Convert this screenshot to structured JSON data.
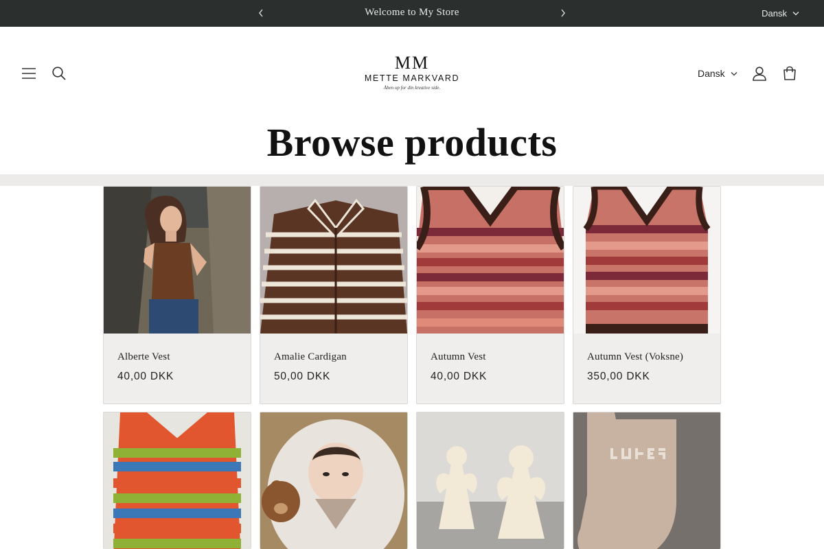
{
  "announcement": {
    "message": "Welcome to My Store",
    "language": "Dansk"
  },
  "header": {
    "logo": {
      "monogram": "MM",
      "brand": "METTE MARKVARD",
      "tagline": "Åben op for din kreative side."
    },
    "language": "Dansk"
  },
  "page": {
    "title": "Browse products"
  },
  "products": [
    {
      "name": "Alberte Vest",
      "price": "40,00 DKK"
    },
    {
      "name": "Amalie Cardigan",
      "price": "50,00 DKK"
    },
    {
      "name": "Autumn Vest",
      "price": "40,00 DKK"
    },
    {
      "name": "Autumn Vest (Voksne)",
      "price": "350,00 DKK"
    },
    {
      "name": "",
      "price": ""
    },
    {
      "name": "",
      "price": ""
    },
    {
      "name": "",
      "price": ""
    },
    {
      "name": "",
      "price": ""
    }
  ],
  "colors": {
    "announcement_bg": "#2b302e",
    "card_bg": "#efeeec",
    "band_bg": "#ecebe9"
  },
  "icons": [
    "chevron-left-icon",
    "chevron-right-icon",
    "chevron-down-icon",
    "menu-icon",
    "search-icon",
    "account-icon",
    "cart-icon"
  ]
}
